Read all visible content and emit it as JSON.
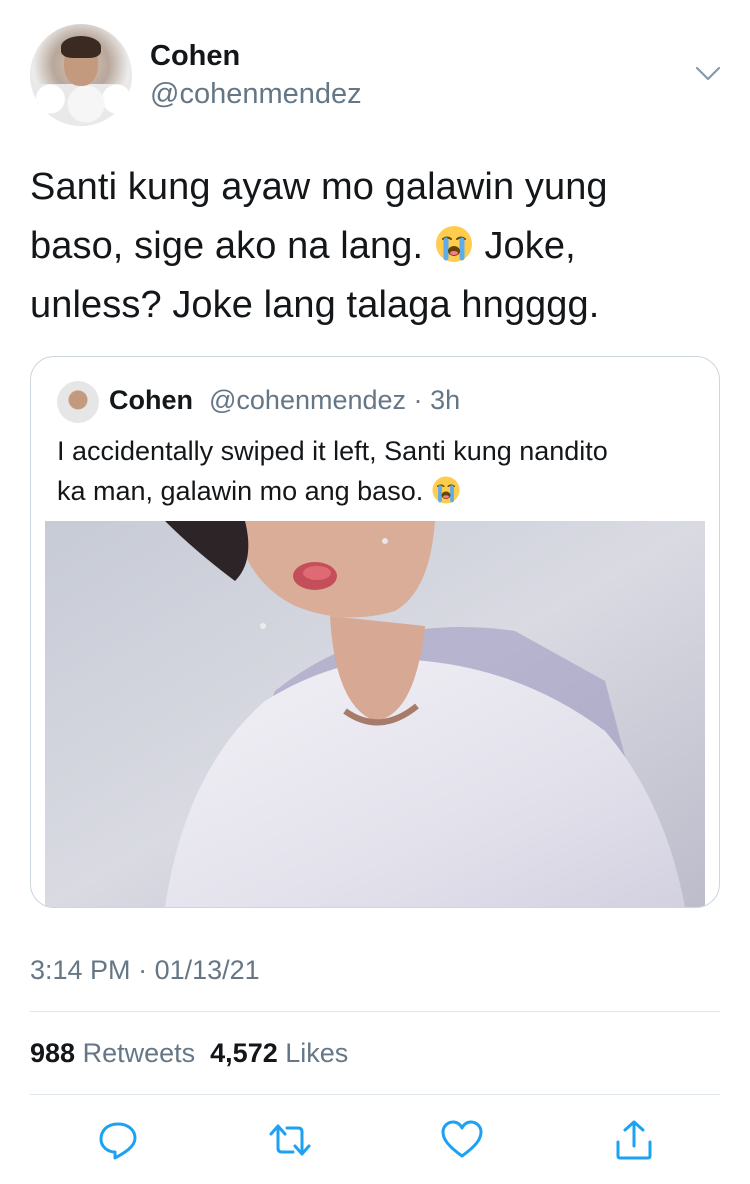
{
  "tweet": {
    "author": {
      "name": "Cohen",
      "handle": "@cohenmendez"
    },
    "text": {
      "line1": "Santi kung ayaw mo galawin yung",
      "line2_before": "baso, sige ako na lang. ",
      "line2_after": " Joke,",
      "line3": "unless? Joke lang talaga hngggg."
    },
    "emoji": "loudly-crying-face"
  },
  "quoted_tweet": {
    "name": "Cohen",
    "handle": "@cohenmendez",
    "separator": "·",
    "age": "3h",
    "text_line1": "I accidentally swiped it left, Santi kung nandito",
    "text_line2": "ka man, galawin mo ang baso. ",
    "emoji": "loudly-crying-face"
  },
  "meta": {
    "time": "3:14 PM",
    "separator": "·",
    "date": "01/13/21"
  },
  "stats": {
    "retweets_count": "988",
    "retweets_label": "Retweets",
    "likes_count": "4,572",
    "likes_label": "Likes"
  },
  "actions": [
    "reply-icon",
    "retweet-icon",
    "like-icon",
    "share-icon"
  ],
  "colors": {
    "text": "#14171a",
    "secondary": "#657786",
    "border": "#ccd6dd",
    "icon": "#1da1f2"
  }
}
